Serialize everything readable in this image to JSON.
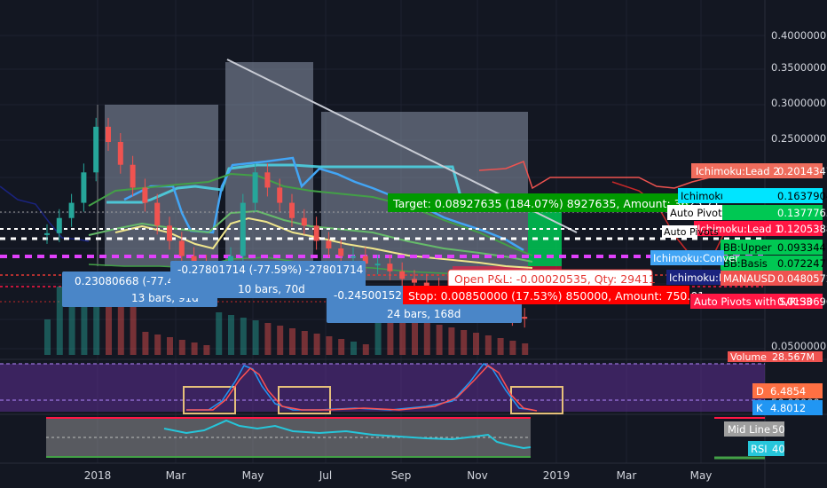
{
  "chart_data": {
    "type": "line",
    "symbol": "MANAUSD",
    "price_axis": {
      "ticks": [
        "0.40000000",
        "0.35000000",
        "0.30000000",
        "0.25000000",
        "0.05000000"
      ],
      "range": [
        0.0,
        0.42
      ]
    },
    "time_axis": {
      "ticks": [
        "2018",
        "Mar",
        "May",
        "Jul",
        "Sep",
        "Nov",
        "2019",
        "Mar",
        "May"
      ]
    },
    "price_labels": [
      {
        "name": "Ichimoku:Lead 2",
        "value": "0.20143472",
        "color": "#ef5350"
      },
      {
        "name": "Ichimoku:Base Line",
        "value": "0.16379044",
        "color": "#00bcd4"
      },
      {
        "name": "Auto Pivots with S/R:R3",
        "value": "0.13777635",
        "color": "#ffffff"
      },
      {
        "name": "Ichimoku:Lead 1",
        "value": "0.12053887",
        "color": "#ff1744"
      },
      {
        "name": "Auto Pivots",
        "value": "",
        "color": "#ffffff"
      },
      {
        "name": "BB:Upper",
        "value": "0.09334475",
        "color": "#4caf50"
      },
      {
        "name": "BB:Basis",
        "value": "0.07224770",
        "color": "#4caf50"
      },
      {
        "name": "Ichimoku:Conver",
        "value": "",
        "color": "#2196f3"
      },
      {
        "name": "Ichimoku:La",
        "value": "",
        "color": "#1a237e"
      },
      {
        "name": "MANAUSD",
        "value": "0.04805726",
        "color": "#ef5350"
      },
      {
        "name": "Auto Pivots with S/R:S3",
        "value": "0.01306969",
        "color": "#ff1744"
      },
      {
        "name": "Volume",
        "value": "28.567M",
        "color": "#ef5350"
      }
    ],
    "oscillator_labels": [
      {
        "name": "D",
        "value": "6.4854",
        "color": "#ff7043"
      },
      {
        "name": "K",
        "value": "4.8012",
        "color": "#2196f3"
      }
    ],
    "rsi_labels": [
      {
        "name": "Mid Line",
        "value": "50",
        "color": "#9e9e9e"
      },
      {
        "name": "RSI",
        "value": "40",
        "color": "#26c6da"
      }
    ],
    "rsi_axis": {
      "tick": "50.00000"
    },
    "measure_boxes": [
      {
        "change": "0.23080668 (-77.4",
        "bars": "13 bars, 91d"
      },
      {
        "change": "-0.27801714 (-77.59%) -27801714",
        "bars": "10 bars, 70d"
      },
      {
        "change": "-0.24500152",
        "bars": "24 bars, 168d"
      }
    ],
    "position": {
      "target": "Target: 0.08927635 (184.07%) 8927635, Amount: 3625.71",
      "open_pl": "Open P&L: -0.00020535, Qty: 29411",
      "stop": "Stop: 0.00850000 (17.53%) 850000, Amount: 750.01"
    },
    "close_series": [
      0.16,
      0.18,
      0.2,
      0.24,
      0.3,
      0.28,
      0.25,
      0.22,
      0.2,
      0.17,
      0.15,
      0.13,
      0.12,
      0.11,
      0.11,
      0.13,
      0.2,
      0.24,
      0.22,
      0.2,
      0.18,
      0.17,
      0.15,
      0.14,
      0.13,
      0.13,
      0.12,
      0.12,
      0.11,
      0.1,
      0.095,
      0.09,
      0.085,
      0.08,
      0.075,
      0.07,
      0.065,
      0.06,
      0.05,
      0.048
    ]
  }
}
